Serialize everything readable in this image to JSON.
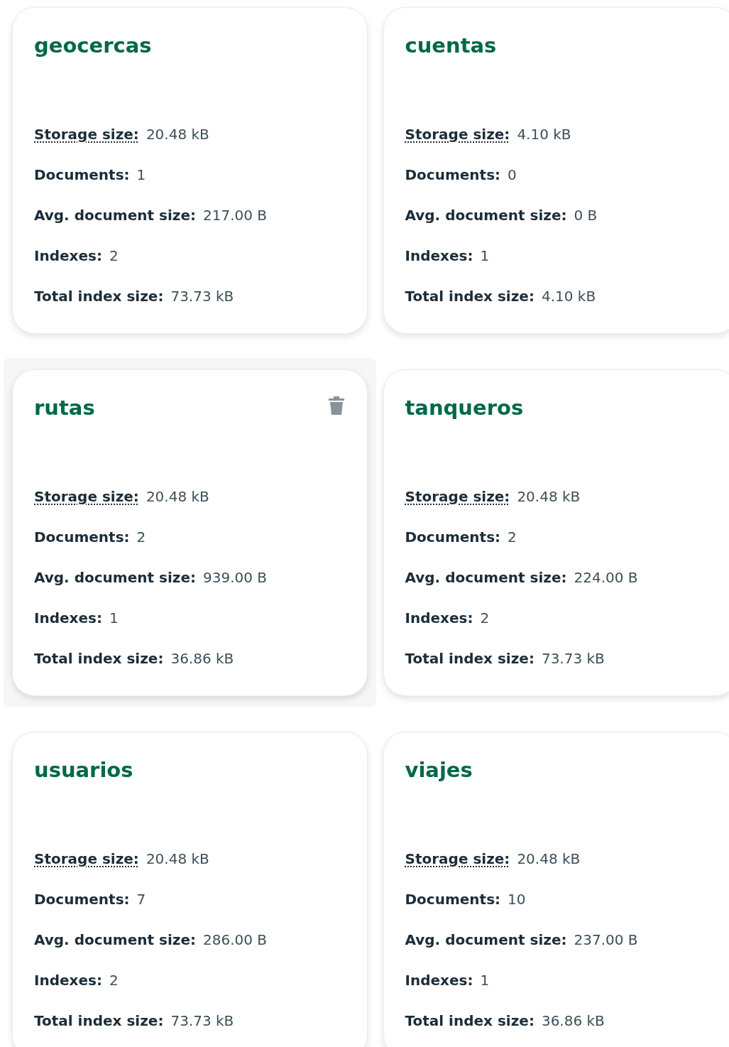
{
  "collections": [
    {
      "name": "geocercas",
      "hovered": false,
      "stats": [
        {
          "label": "Storage size:",
          "value": "20.48 kB",
          "dotted": true
        },
        {
          "label": "Documents:",
          "value": "1",
          "dotted": false
        },
        {
          "label": "Avg. document size:",
          "value": "217.00 B",
          "dotted": false
        },
        {
          "label": "Indexes:",
          "value": "2",
          "dotted": false
        },
        {
          "label": "Total index size:",
          "value": "73.73 kB",
          "dotted": false
        }
      ]
    },
    {
      "name": "cuentas",
      "hovered": false,
      "stats": [
        {
          "label": "Storage size:",
          "value": "4.10 kB",
          "dotted": true
        },
        {
          "label": "Documents:",
          "value": "0",
          "dotted": false
        },
        {
          "label": "Avg. document size:",
          "value": "0 B",
          "dotted": false
        },
        {
          "label": "Indexes:",
          "value": "1",
          "dotted": false
        },
        {
          "label": "Total index size:",
          "value": "4.10 kB",
          "dotted": false
        }
      ]
    },
    {
      "name": "rutas",
      "hovered": true,
      "stats": [
        {
          "label": "Storage size:",
          "value": "20.48 kB",
          "dotted": true
        },
        {
          "label": "Documents:",
          "value": "2",
          "dotted": false
        },
        {
          "label": "Avg. document size:",
          "value": "939.00 B",
          "dotted": false
        },
        {
          "label": "Indexes:",
          "value": "1",
          "dotted": false
        },
        {
          "label": "Total index size:",
          "value": "36.86 kB",
          "dotted": false
        }
      ]
    },
    {
      "name": "tanqueros",
      "hovered": false,
      "stats": [
        {
          "label": "Storage size:",
          "value": "20.48 kB",
          "dotted": true
        },
        {
          "label": "Documents:",
          "value": "2",
          "dotted": false
        },
        {
          "label": "Avg. document size:",
          "value": "224.00 B",
          "dotted": false
        },
        {
          "label": "Indexes:",
          "value": "2",
          "dotted": false
        },
        {
          "label": "Total index size:",
          "value": "73.73 kB",
          "dotted": false
        }
      ]
    },
    {
      "name": "usuarios",
      "hovered": false,
      "stats": [
        {
          "label": "Storage size:",
          "value": "20.48 kB",
          "dotted": true
        },
        {
          "label": "Documents:",
          "value": "7",
          "dotted": false
        },
        {
          "label": "Avg. document size:",
          "value": "286.00 B",
          "dotted": false
        },
        {
          "label": "Indexes:",
          "value": "2",
          "dotted": false
        },
        {
          "label": "Total index size:",
          "value": "73.73 kB",
          "dotted": false
        }
      ]
    },
    {
      "name": "viajes",
      "hovered": false,
      "stats": [
        {
          "label": "Storage size:",
          "value": "20.48 kB",
          "dotted": true
        },
        {
          "label": "Documents:",
          "value": "10",
          "dotted": false
        },
        {
          "label": "Avg. document size:",
          "value": "237.00 B",
          "dotted": false
        },
        {
          "label": "Indexes:",
          "value": "1",
          "dotted": false
        },
        {
          "label": "Total index size:",
          "value": "36.86 kB",
          "dotted": false
        }
      ]
    }
  ]
}
